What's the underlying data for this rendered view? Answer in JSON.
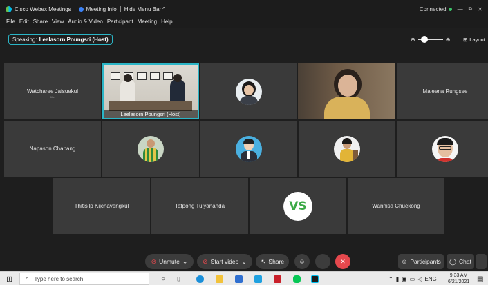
{
  "titlebar": {
    "app_name": "Cisco Webex Meetings",
    "meeting_info": "Meeting Info",
    "hide_menu_bar": "Hide Menu Bar ^",
    "status": "Connected",
    "minimize": "—",
    "restore": "⧉",
    "close": "✕"
  },
  "menu": [
    "File",
    "Edit",
    "Share",
    "View",
    "Audio & Video",
    "Participant",
    "Meeting",
    "Help"
  ],
  "speaking": {
    "prefix": "Speaking:",
    "name": "Leelasorn Poungsri (Host)"
  },
  "zoom": {
    "level": 0.25,
    "minus": "⊖",
    "plus": "⊕"
  },
  "layout_label": "Layout",
  "participants": {
    "p1": {
      "name": "Watcharee Jaisuekul",
      "sub": "Me"
    },
    "host": {
      "name": "Leelasorn Poungsri (Host)"
    },
    "p3": {
      "name": "Maleena Rungsee"
    },
    "p4": {
      "name": "Napason Chabang"
    },
    "p5": {
      "name": "Thitisilp Kijchavengkul"
    },
    "p6": {
      "name": "Tatpong Tulyananda"
    },
    "p7": {
      "name": "VS"
    },
    "p8": {
      "name": "Wannisa Chuekong"
    }
  },
  "controls": {
    "unmute": "Unmute",
    "start_video": "Start video",
    "share": "Share",
    "participants": "Participants",
    "chat": "Chat",
    "more": "···"
  },
  "taskbar": {
    "search_placeholder": "Type here to search",
    "lang": "ENG",
    "time": "9:33 AM",
    "date": "6/21/2021"
  },
  "colors": {
    "accent": "#2bb5c6",
    "danger": "#e5484d",
    "vs_green": "#3ba946"
  }
}
